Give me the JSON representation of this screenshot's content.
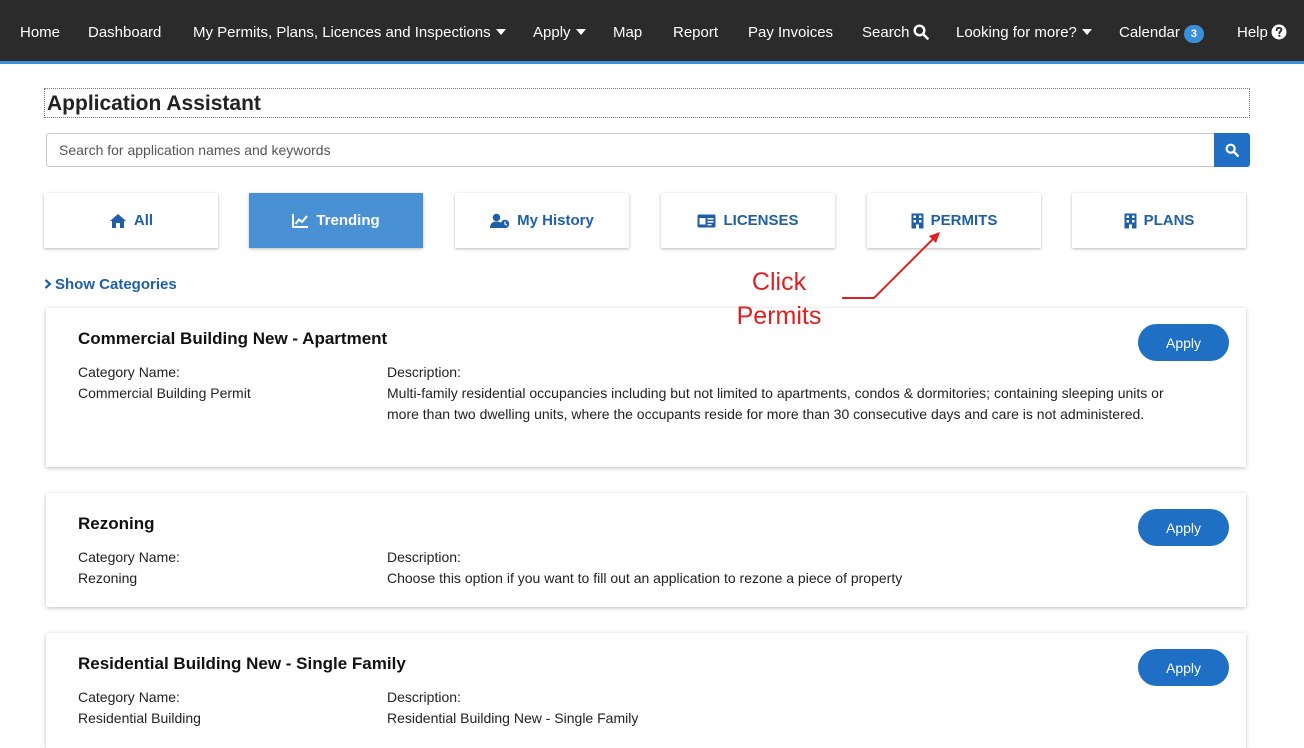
{
  "nav": {
    "home": "Home",
    "dashboard": "Dashboard",
    "my_permits": "My Permits, Plans, Licences and Inspections",
    "apply": "Apply",
    "map": "Map",
    "report": "Report",
    "pay_invoices": "Pay Invoices",
    "search": "Search",
    "looking_for_more": "Looking for more?",
    "calendar": "Calendar",
    "calendar_count": "3",
    "help": "Help"
  },
  "page": {
    "title": "Application Assistant"
  },
  "search": {
    "placeholder": "Search for application names and keywords",
    "value": ""
  },
  "tabs": [
    {
      "label": "All",
      "icon": "home-icon"
    },
    {
      "label": "Trending",
      "icon": "trend-chart-icon",
      "active": true
    },
    {
      "label": "My History",
      "icon": "user-history-icon"
    },
    {
      "label": "LICENSES",
      "icon": "id-card-icon"
    },
    {
      "label": "PERMITS",
      "icon": "building-icon"
    },
    {
      "label": "PLANS",
      "icon": "building-icon"
    }
  ],
  "show_categories": "Show Categories",
  "annotation": {
    "line1": "Click",
    "line2": "Permits",
    "color": "#e02020"
  },
  "cards": [
    {
      "title": "Commercial Building New - Apartment",
      "category_label": "Category Name:",
      "category": "Commercial Building Permit",
      "description_label": "Description:",
      "description": "Multi-family residential occupancies including but not limited to apartments, condos & dormitories; containing sleeping units or more than two dwelling units, where the occupants reside for more than 30 consecutive days and care is not administered.",
      "apply_label": "Apply"
    },
    {
      "title": "Rezoning",
      "category_label": "Category Name:",
      "category": "Rezoning",
      "description_label": "Description:",
      "description": "Choose this option if you want to fill out an application to rezone a piece of property",
      "apply_label": "Apply"
    },
    {
      "title": "Residential Building New - Single Family",
      "category_label": "Category Name:",
      "category": "Residential Building",
      "description_label": "Description:",
      "description": "Residential Building New - Single Family",
      "apply_label": "Apply"
    }
  ],
  "colors": {
    "nav_bg": "#2b2b2b",
    "accent": "#1f6fc5",
    "tab_active": "#4a90d4",
    "link": "#1f5fa8"
  }
}
